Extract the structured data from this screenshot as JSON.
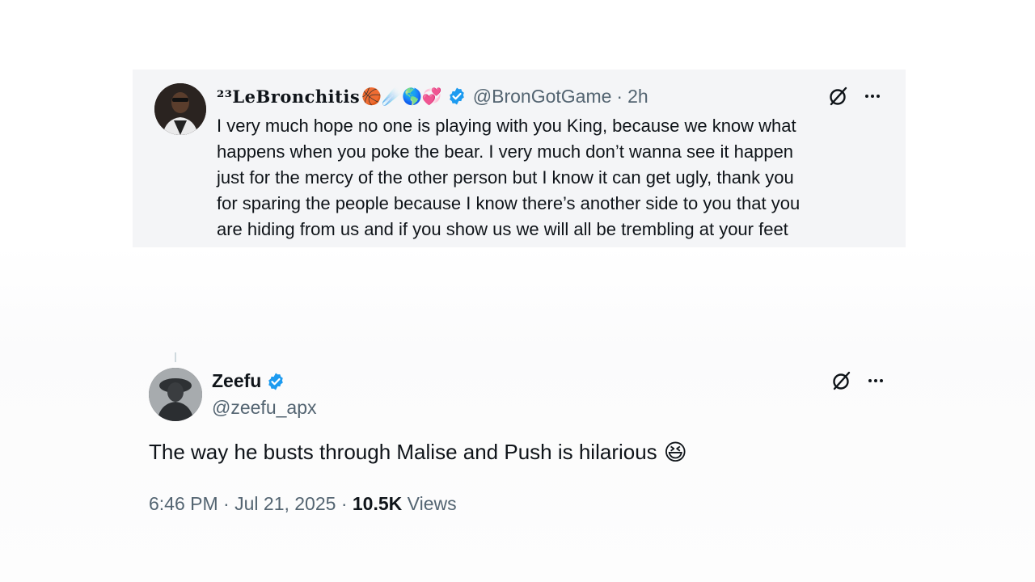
{
  "quoted_tweet": {
    "display_name": "²³LeBronchitis",
    "name_emojis": "🏀☄️🌎💞",
    "handle": "@BronGotGame",
    "separator": "·",
    "time": "2h",
    "text_lines": [
      "I very much hope no one is playing with you King, because we know what",
      "happens when you poke the bear. I very much don’t wanna see it happen",
      "just for the mercy of the other person but I know it can get ugly, thank you",
      "for sparing the people because I know there’s another side to you that you",
      "are hiding from us and if you show us we will all be trembling at your feet"
    ]
  },
  "main_tweet": {
    "display_name": "Zeefu",
    "handle": "@zeefu_apx",
    "text": "The way he busts through Malise and Push is hilarious",
    "emoji": "😆",
    "time": "6:46 PM",
    "date": "Jul 21, 2025",
    "separator": "·",
    "views_count": "10.5K",
    "views_label": "Views"
  },
  "icons": {
    "verified": "verified-badge-icon",
    "grok": "grok-icon",
    "more": "more-icon"
  },
  "colors": {
    "verified_blue": "#1d9bf0",
    "text_primary": "#0f1419",
    "text_secondary": "#536471",
    "quote_bg": "#f4f5f7"
  }
}
